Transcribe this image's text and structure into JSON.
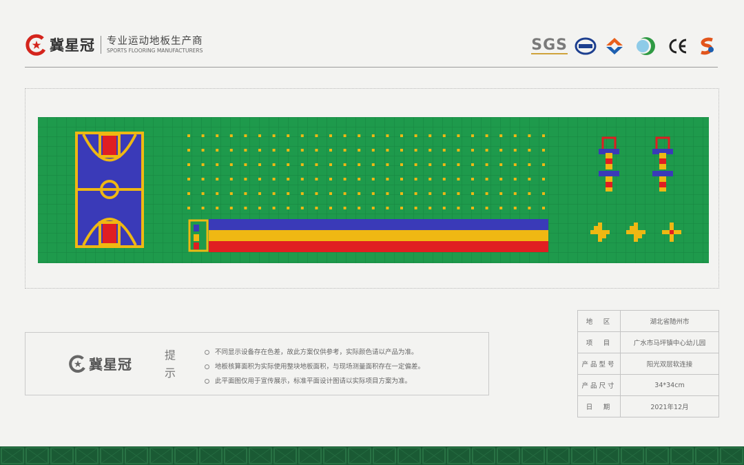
{
  "brand": {
    "name": "冀星冠",
    "tagline_cn": "专业运动地板生产商",
    "tagline_en": "SPORTS FLOORING MANUFACTURERS"
  },
  "certifications": {
    "sgs": "SGS",
    "icons": [
      "cnas-icon",
      "quality-arrow-icon",
      "green-circle-icon",
      "ce-mark-icon",
      "s-mark-icon"
    ],
    "ce_text": "CE"
  },
  "colors": {
    "court_green": "#1e9a4c",
    "court_blue": "#3a3ab8",
    "court_yellow": "#efb813",
    "court_red": "#e01e22",
    "bottom_green": "#1a5a34",
    "brand_red": "#d4241c"
  },
  "tips": {
    "title": "提示",
    "items": [
      "不同显示设备存在色差，故此方案仅供参考，实际颜色请以产品为准。",
      "地板核算面积为实际使用整块地板面积，与现场测量面积存在一定偏差。",
      "此平面图仅用于宣传展示，标准平面设计图请以实际项目方案为准。"
    ]
  },
  "info": [
    {
      "key": "地　区",
      "value": "湖北省随州市"
    },
    {
      "key": "项　目",
      "value": "广水市马坪镇中心幼儿园"
    },
    {
      "key": "产品型号",
      "value": "阳光双层软连接"
    },
    {
      "key": "产品尺寸",
      "value": "34*34cm"
    },
    {
      "key": "日　期",
      "value": "2021年12月"
    }
  ]
}
